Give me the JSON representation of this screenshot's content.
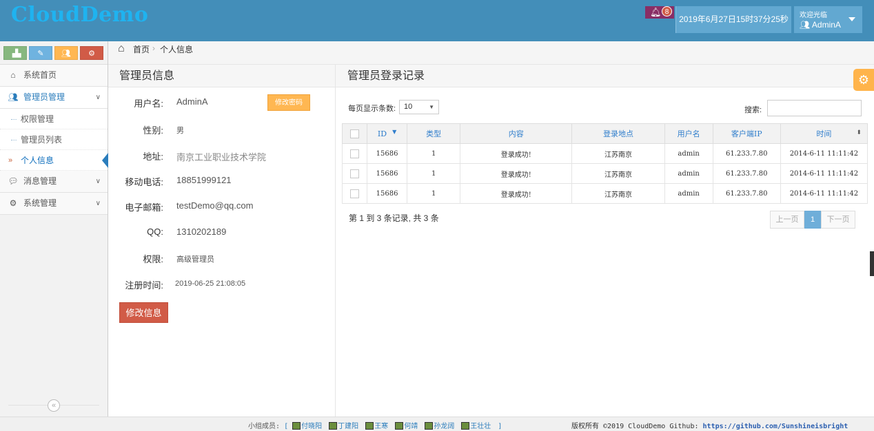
{
  "header": {
    "brand": "CloudDemo",
    "notification_count": "8",
    "datetime": "2019年6月27日15时37分25秒",
    "welcome": "欢迎光临",
    "user": "AdminA"
  },
  "sidebar": {
    "shortcut_colors": [
      "#87b87f",
      "#6fb3e0",
      "#ffb752",
      "#d15b47"
    ],
    "items": [
      {
        "label": "系统首页",
        "icon": "home-icon"
      },
      {
        "label": "管理员管理",
        "icon": "users-icon"
      },
      {
        "label": "权限管理"
      },
      {
        "label": "管理员列表"
      },
      {
        "label": "个人信息"
      },
      {
        "label": "消息管理",
        "icon": "comments-icon"
      },
      {
        "label": "系统管理",
        "icon": "cogs-icon"
      }
    ]
  },
  "breadcrumb": {
    "home": "首页",
    "current": "个人信息"
  },
  "admin_info": {
    "title": "管理员信息",
    "change_password": "修改密码",
    "edit_button": "修改信息",
    "fields": [
      {
        "label": "用户名:",
        "value": "AdminA"
      },
      {
        "label": "性别:",
        "value": "男"
      },
      {
        "label": "地址:",
        "value": "南京工业职业技术学院"
      },
      {
        "label": "移动电话:",
        "value": "18851999121"
      },
      {
        "label": "电子邮箱:",
        "value": "testDemo@qq.com"
      },
      {
        "label": "QQ:",
        "value": "1310202189"
      },
      {
        "label": "权限:",
        "value": "高级管理员"
      },
      {
        "label": "注册时间:",
        "value": "2019-06-25 21:08:05"
      }
    ]
  },
  "login_log": {
    "title": "管理员登录记录",
    "page_size_label": "每页显示条数:",
    "page_size": "10",
    "search_label": "搜索:",
    "columns": [
      "ID",
      "类型",
      "内容",
      "登录地点",
      "用户名",
      "客户端IP",
      "时间"
    ],
    "rows": [
      [
        "15686",
        "1",
        "登录成功!",
        "江苏南京",
        "admin",
        "61.233.7.80",
        "2014-6-11 11:11:42"
      ],
      [
        "15686",
        "1",
        "登录成功!",
        "江苏南京",
        "admin",
        "61.233.7.80",
        "2014-6-11 11:11:42"
      ],
      [
        "15686",
        "1",
        "登录成功!",
        "江苏南京",
        "admin",
        "61.233.7.80",
        "2014-6-11 11:11:42"
      ]
    ],
    "records_info": "第 1 到 3 条记录, 共 3 条",
    "pager": {
      "prev": "上一页",
      "current": "1",
      "next": "下一页"
    }
  },
  "footer": {
    "team_label": "小组成员:",
    "open_bracket": "[",
    "close_bracket": "]",
    "members": [
      "付晓阳",
      "丁建阳",
      "王寒",
      "何靖",
      "孙龙阔",
      "王壮壮"
    ],
    "copyright": "版权所有 ©2019 CloudDemo Github:",
    "github": "https://github.com/Sunshineisbright"
  }
}
